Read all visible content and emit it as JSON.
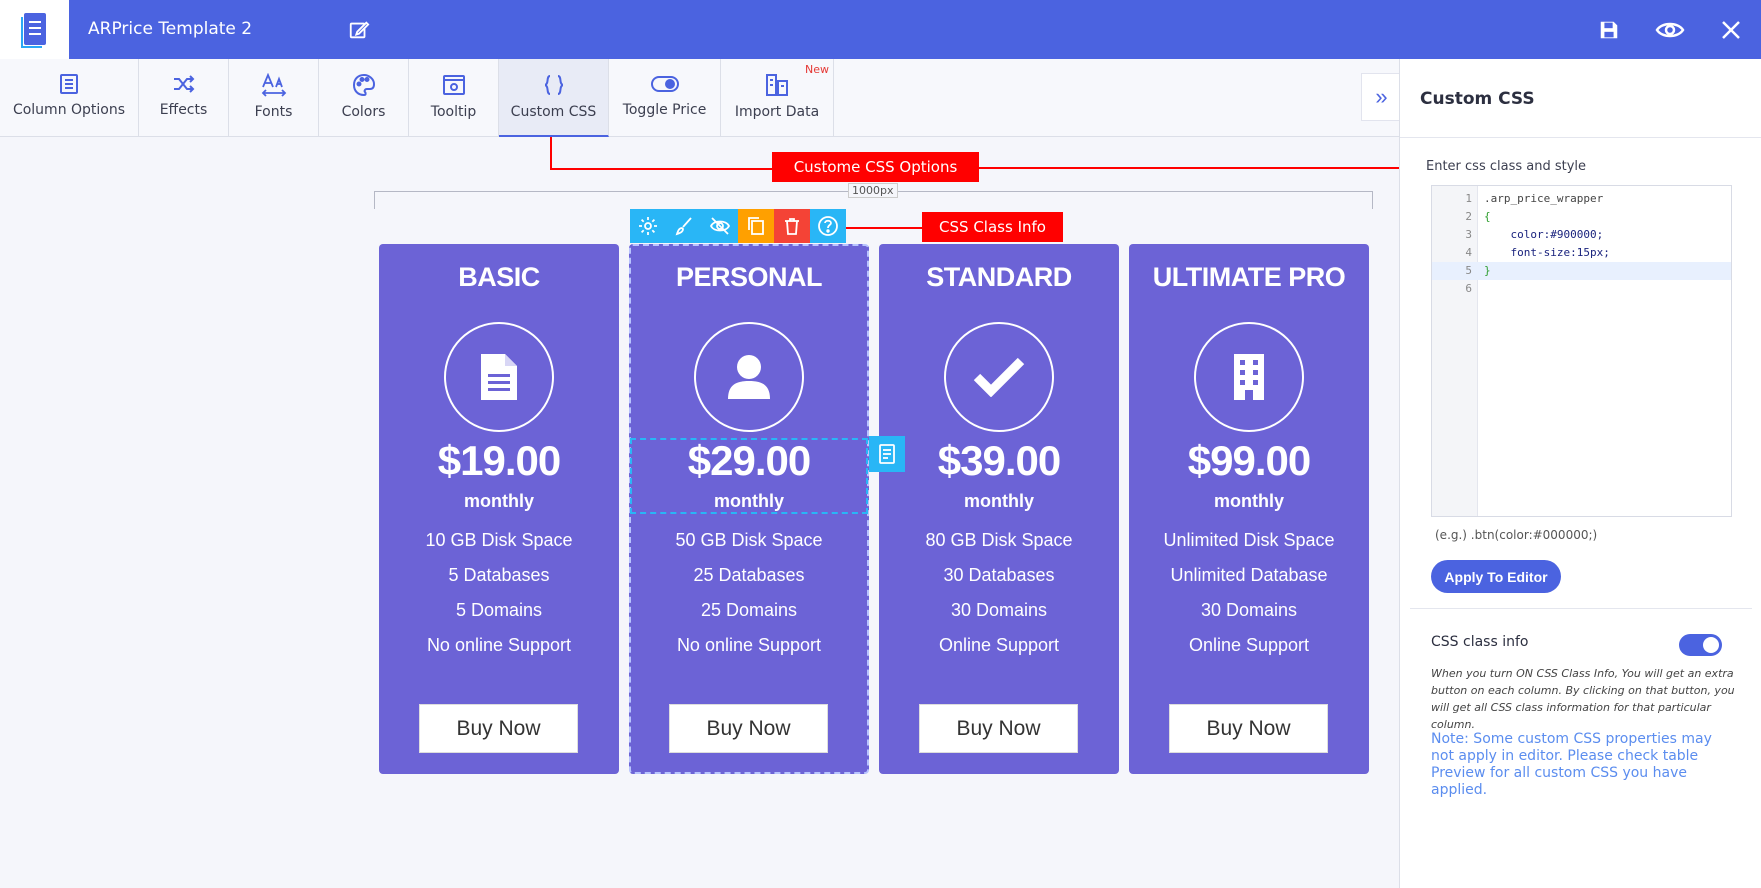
{
  "app": {
    "title": "ARPrice Template 2"
  },
  "colors": {
    "header": "#4b63e0",
    "column_bg": "#6c63d6",
    "annotation_red": "#ff0000",
    "accent_cyan": "#29b6f6"
  },
  "header": {
    "icons": [
      "edit-icon",
      "save-icon",
      "preview-icon",
      "close-icon"
    ]
  },
  "toolbar": {
    "items": [
      {
        "label": "Column Options",
        "icon": "column-options-icon"
      },
      {
        "label": "Effects",
        "icon": "shuffle-icon"
      },
      {
        "label": "Fonts",
        "icon": "fonts-icon"
      },
      {
        "label": "Colors",
        "icon": "palette-icon"
      },
      {
        "label": "Tooltip",
        "icon": "tooltip-icon"
      },
      {
        "label": "Custom CSS",
        "icon": "braces-icon",
        "active": true
      },
      {
        "label": "Toggle Price",
        "icon": "toggle-icon"
      },
      {
        "label": "Import Data",
        "icon": "import-data-icon",
        "badge": "New"
      }
    ]
  },
  "annotations": {
    "custom_css_options": "Custome CSS Options",
    "css_class_info": "CSS Class Info",
    "ruler": "1000px"
  },
  "columns": [
    {
      "title": "BASIC",
      "price": "$19.00",
      "period": "monthly",
      "icon": "document-icon",
      "features": [
        "10 GB Disk Space",
        "5 Databases",
        "5 Domains",
        "No online Support"
      ],
      "button": "Buy Now"
    },
    {
      "title": "PERSONAL",
      "price": "$29.00",
      "period": "monthly",
      "icon": "user-icon",
      "features": [
        "50 GB Disk Space",
        "25 Databases",
        "25 Domains",
        "No online Support"
      ],
      "button": "Buy Now"
    },
    {
      "title": "STANDARD",
      "price": "$39.00",
      "period": "monthly",
      "icon": "checkmark-icon",
      "features": [
        "80 GB Disk Space",
        "30 Databases",
        "30 Domains",
        "Online Support"
      ],
      "button": "Buy Now"
    },
    {
      "title": "ULTIMATE PRO",
      "price": "$99.00",
      "period": "monthly",
      "icon": "building-icon",
      "features": [
        "Unlimited Disk Space",
        "Unlimited Database",
        "30 Domains",
        "Online Support"
      ],
      "button": "Buy Now"
    }
  ],
  "panel": {
    "title": "Custom CSS",
    "label": "Enter css class and style",
    "code_lines": [
      {
        "n": "1",
        "text": ".arp_price_wrapper"
      },
      {
        "n": "2",
        "text": "{"
      },
      {
        "n": "3",
        "text": "    color:#900000;"
      },
      {
        "n": "4",
        "text": "    font-size:15px;"
      },
      {
        "n": "5",
        "text": "}"
      },
      {
        "n": "6",
        "text": ""
      }
    ],
    "example": "(e.g.) .btn(color:#000000;)",
    "apply_button": "Apply To Editor",
    "toggle_label": "CSS class info",
    "toggle_on": true,
    "description": "When you turn ON CSS Class Info, You will get an extra button on each column. By clicking on that button, you will get all CSS class information for that particular column.",
    "note": "Note: Some custom CSS properties may not apply in editor. Please check table Preview for all custom CSS you have applied."
  }
}
